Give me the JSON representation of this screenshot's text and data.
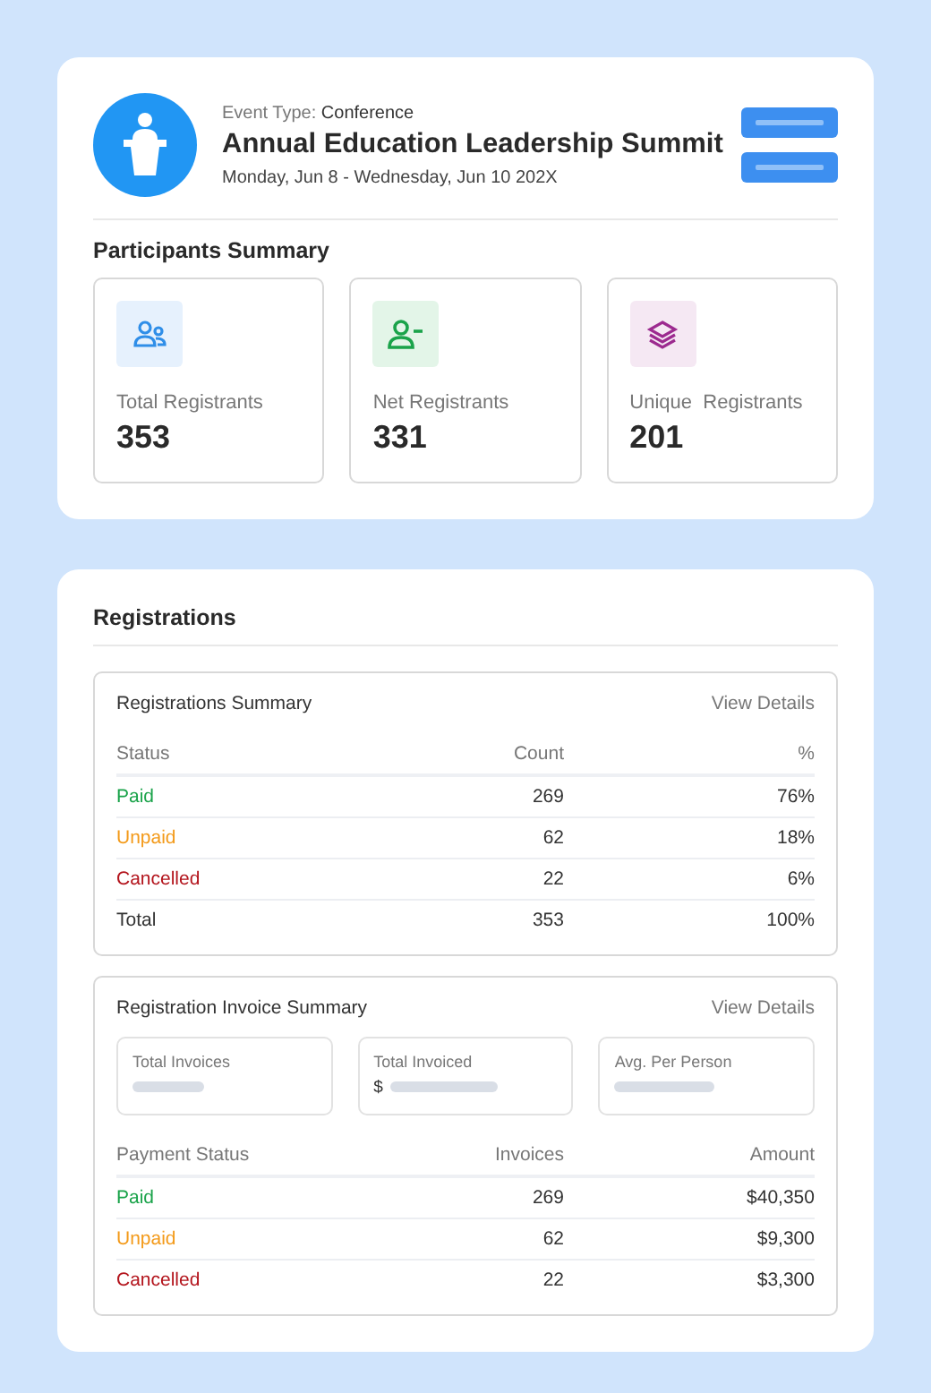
{
  "event": {
    "type_label": "Event Type:",
    "type_value": "Conference",
    "title": "Annual Education Leadership Summit",
    "dates": "Monday, Jun 8 - Wednesday, Jun 10 202X"
  },
  "participants": {
    "title": "Participants Summary",
    "cards": [
      {
        "kind": "people",
        "color": "#2f8ee8",
        "label": "Total Registrants",
        "value": "353"
      },
      {
        "kind": "person-minus",
        "color": "#1aa34a",
        "label": "Net Registrants",
        "value": "331"
      },
      {
        "kind": "layers",
        "color": "#9c2a8f",
        "label": "Unique  Registrants",
        "value": "201"
      }
    ]
  },
  "registrations": {
    "title": "Registrations",
    "summary": {
      "title": "Registrations Summary",
      "link": "View Details",
      "columns": [
        "Status",
        "Count",
        "%"
      ],
      "rows": [
        {
          "status": "Paid",
          "color": "#1aa34a",
          "count": "269",
          "pct": "76%"
        },
        {
          "status": "Unpaid",
          "color": "#f39a1a",
          "count": "62",
          "pct": "18%"
        },
        {
          "status": "Cancelled",
          "color": "#b3141c",
          "count": "22",
          "pct": "6%"
        },
        {
          "status": "Total",
          "color": "#333333",
          "count": "353",
          "pct": "100%"
        }
      ]
    },
    "invoice": {
      "title": "Registration Invoice Summary",
      "link": "View Details",
      "boxes": [
        {
          "label": "Total Invoices"
        },
        {
          "label": "Total Invoiced",
          "prefix": "$"
        },
        {
          "label": "Avg. Per Person"
        }
      ],
      "columns": [
        "Payment Status",
        "Invoices",
        "Amount"
      ],
      "rows": [
        {
          "status": "Paid",
          "color": "#1aa34a",
          "count": "269",
          "amount": "$40,350"
        },
        {
          "status": "Unpaid",
          "color": "#f39a1a",
          "count": "62",
          "amount": "$9,300"
        },
        {
          "status": "Cancelled",
          "color": "#b3141c",
          "count": "22",
          "amount": "$3,300"
        }
      ]
    }
  }
}
